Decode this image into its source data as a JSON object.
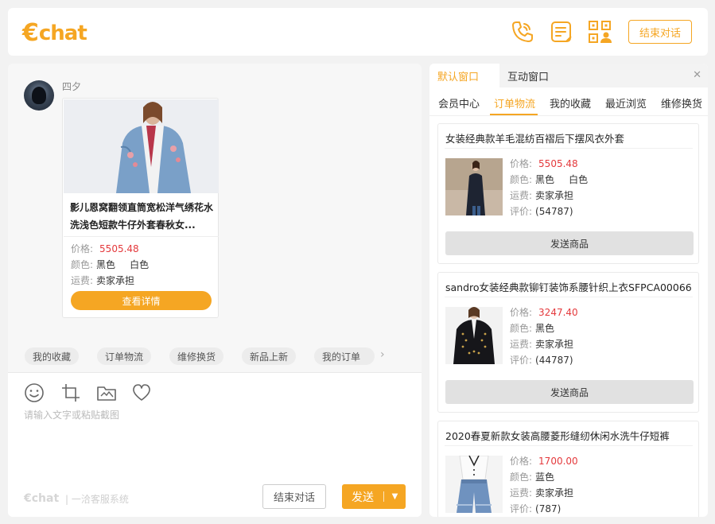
{
  "header": {
    "logo": "chat",
    "end_chat": "结束对话",
    "icons": [
      "phone-icon",
      "note-icon",
      "qrcode-user-icon"
    ]
  },
  "chat": {
    "sender": "四夕",
    "card": {
      "title": "影儿恩窝翻领直筒宽松洋气绣花水洗浅色短款牛仔外套春秋女...",
      "price_label": "价格:",
      "price": "5505.48",
      "color_label": "颜色:",
      "color1": "黑色",
      "color2": "白色",
      "ship_label": "运费:",
      "ship": "卖家承担",
      "detail_button": "查看详情"
    },
    "quick_replies": [
      "我的收藏",
      "订单物流",
      "维修换货",
      "新品上新",
      "我的订单"
    ],
    "input_placeholder": "请输入文字或粘贴截图",
    "footer_logo": "chat",
    "footer_text": "| 一洽客服系统",
    "end_button": "结束对话",
    "send_button": "发送"
  },
  "side": {
    "window_tabs": [
      "默认窗口",
      "互动窗口"
    ],
    "sub_tabs": [
      "会员中心",
      "订单物流",
      "我的收藏",
      "最近浏览",
      "维修换货"
    ],
    "active_sub_tab": "订单物流",
    "products": [
      {
        "title": "女装经典款羊毛混纺百褶后下摆风衣外套",
        "price": "5505.48",
        "color1": "黑色",
        "color2": "白色",
        "ship": "卖家承担",
        "reviews": "(54787)"
      },
      {
        "title": "sandro女装经典款铆钉装饰系腰针织上衣SFPCA00066",
        "price": "3247.40",
        "color1": "黑色",
        "color2": "",
        "ship": "卖家承担",
        "reviews": "(44787)"
      },
      {
        "title": "2020春夏新款女装高腰菱形缝纫休闲水洗牛仔短裤",
        "price": "1700.00",
        "color1": "蓝色",
        "color2": "",
        "ship": "卖家承担",
        "reviews": "(787)"
      }
    ],
    "labels": {
      "price": "价格:",
      "color": "颜色:",
      "ship": "运费:",
      "review": "评价:",
      "send_product": "发送商品"
    }
  },
  "colors": {
    "accent": "#f5a623",
    "price": "#e4393c"
  }
}
